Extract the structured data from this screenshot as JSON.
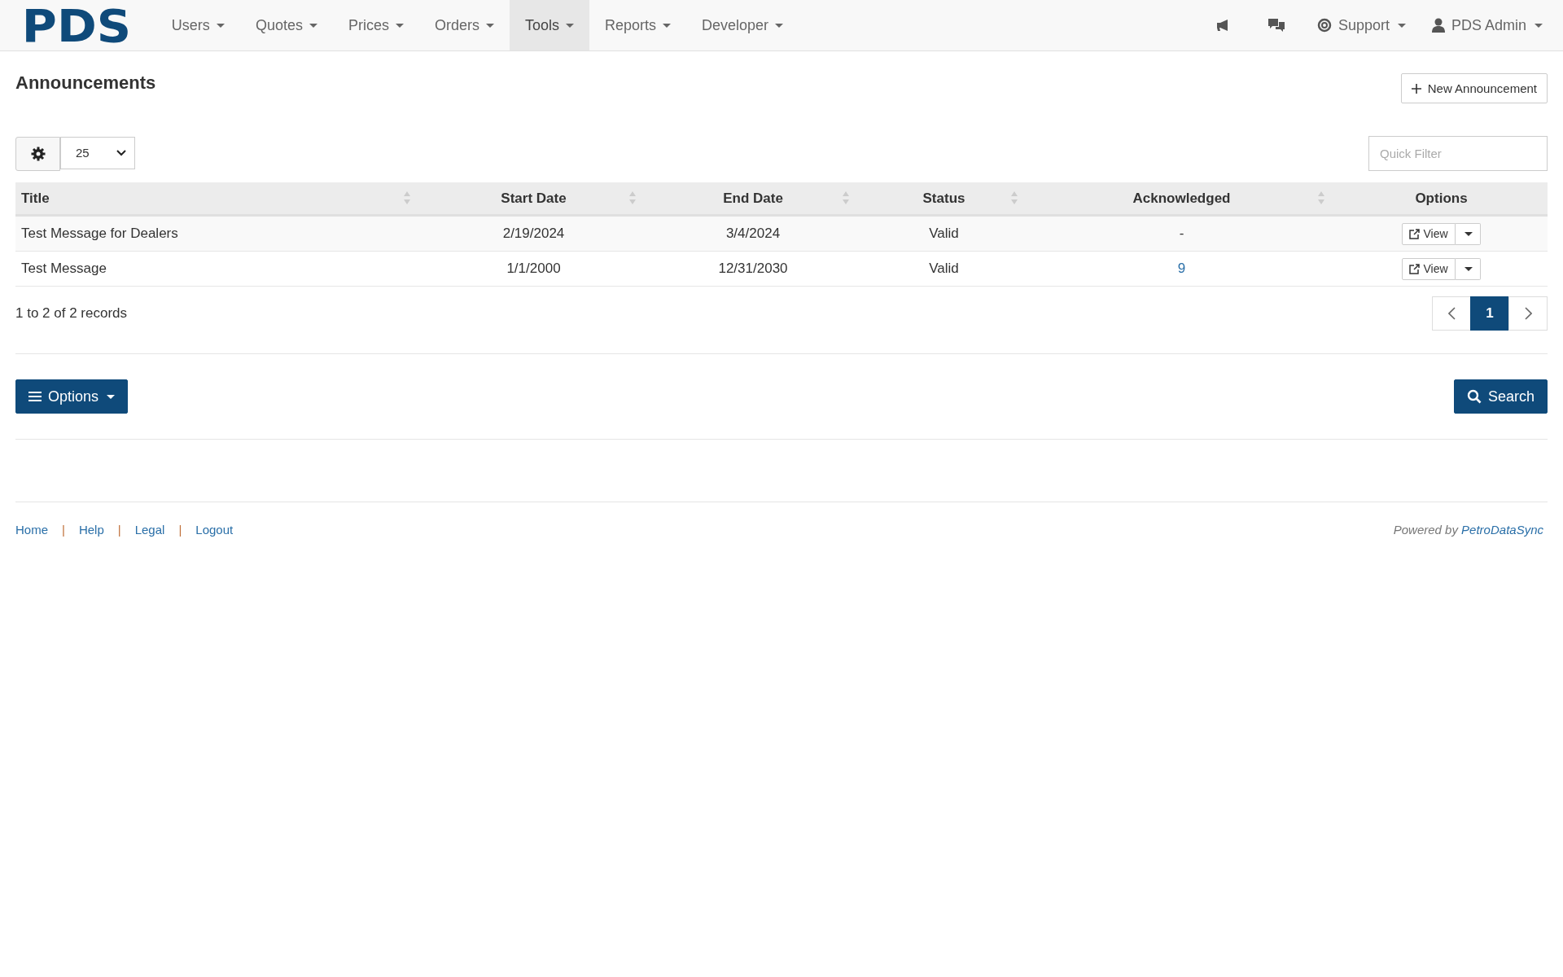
{
  "navbar": {
    "logo": "PDS",
    "items": [
      {
        "label": "Users",
        "selected": false
      },
      {
        "label": "Quotes",
        "selected": false
      },
      {
        "label": "Prices",
        "selected": false
      },
      {
        "label": "Orders",
        "selected": false
      },
      {
        "label": "Tools",
        "selected": true
      },
      {
        "label": "Reports",
        "selected": false
      },
      {
        "label": "Developer",
        "selected": false
      }
    ],
    "support": "Support",
    "user": "PDS Admin"
  },
  "page": {
    "title": "Announcements",
    "new_button": "New Announcement"
  },
  "toolbar": {
    "page_size": "25",
    "filter": {
      "placeholder": "Quick Filter"
    }
  },
  "table": {
    "columns": [
      {
        "label": "Title",
        "sortable": true
      },
      {
        "label": "Start Date",
        "sortable": true
      },
      {
        "label": "End Date",
        "sortable": true
      },
      {
        "label": "Status",
        "sortable": true
      },
      {
        "label": "Acknowledged",
        "sortable": true
      },
      {
        "label": "Options",
        "sortable": false
      }
    ],
    "rows": [
      {
        "title": "Test Message for Dealers",
        "start": "2/19/2024",
        "end": "3/4/2024",
        "status": "Valid",
        "acknowledged": {
          "kind": "plain",
          "text": "-"
        },
        "action": "View"
      },
      {
        "title": "Test Message",
        "start": "1/1/2000",
        "end": "12/31/2030",
        "status": "Valid",
        "acknowledged": {
          "kind": "link",
          "text": "9"
        },
        "action": "View"
      }
    ]
  },
  "records": "1 to 2 of 2 records",
  "pagination": [
    {
      "label": "1",
      "selected": true
    }
  ],
  "options_button": "Options",
  "search_button": "Search",
  "footer": {
    "links": [
      "Home",
      "Help",
      "Legal",
      "Logout"
    ],
    "separator": "|",
    "powered_prefix": "Powered by",
    "powered_link": "PetroDataSync"
  }
}
